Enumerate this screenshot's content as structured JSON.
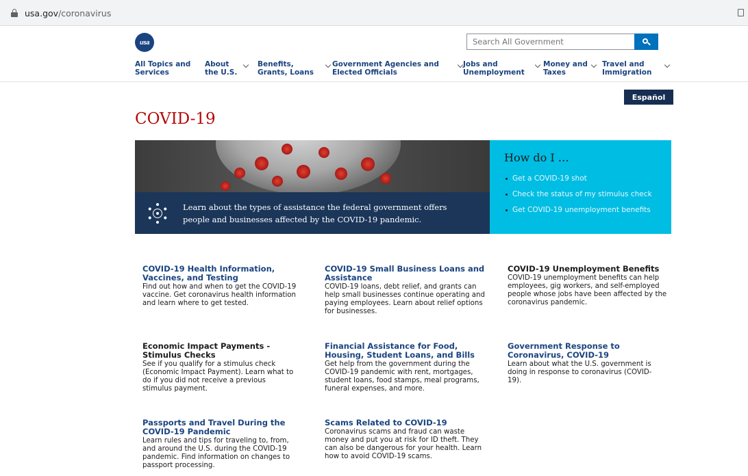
{
  "browser": {
    "url_host": "usa.gov",
    "url_path": "/coronavirus"
  },
  "header": {
    "logo_text": "usa",
    "search_placeholder": "Search All Government",
    "espanol_label": "Español"
  },
  "nav": [
    {
      "label": "All Topics and\nServices"
    },
    {
      "label": "About\nthe U.S."
    },
    {
      "label": "Benefits,\nGrants, Loans"
    },
    {
      "label": "Government Agencies and\nElected Officials"
    },
    {
      "label": "Jobs and\nUnemployment"
    },
    {
      "label": "Money and\nTaxes"
    },
    {
      "label": "Travel and\nImmigration"
    }
  ],
  "page": {
    "title": "COVID-19"
  },
  "hero": {
    "text": "Learn about the types of assistance the federal government offers people and businesses affected by the COVID-19 pandemic."
  },
  "howdoi": {
    "heading": "How do I …",
    "links": [
      "Get a COVID-19 shot",
      "Check the status of my stimulus check",
      "Get COVID-19 unemployment benefits"
    ]
  },
  "cards": [
    {
      "title": "COVID-19 Health Information, Vaccines, and Testing",
      "desc": "Find out how and when to get the COVID-19 vaccine. Get coronavirus health information and learn where to get tested."
    },
    {
      "title": "COVID-19 Small Business Loans and Assistance",
      "desc": "COVID-19 loans, debt relief, and grants can help small businesses continue operating and paying employees. Learn about relief options for businesses."
    },
    {
      "title": "COVID-19 Unemployment Benefits",
      "desc": "COVID-19 unemployment benefits can help employees, gig workers, and self-employed people whose jobs have been affected by the coronavirus pandemic."
    },
    {
      "title": "Economic Impact Payments - Stimulus Checks",
      "desc": "See if you qualify for a stimulus check (Economic Impact Payment). Learn what to do if you did not receive a previous stimulus payment."
    },
    {
      "title": "Financial Assistance for Food, Housing, Student Loans, and Bills",
      "desc": "Get help from the government during the COVID-19 pandemic with rent, mortgages, student loans, food stamps, meal programs, funeral expenses, and more."
    },
    {
      "title": "Government Response to Coronavirus, COVID-19",
      "desc": "Learn about what the U.S. government is doing in response to coronavirus (COVID-19)."
    },
    {
      "title": "Passports and Travel During the COVID-19 Pandemic",
      "desc": "Learn rules and tips for traveling to, from, and around the U.S. during the COVID-19 pandemic. Find information on changes to passport processing."
    },
    {
      "title": "Scams Related to COVID-19",
      "desc": "Coronavirus scams and fraud can waste money and put you at risk for ID theft. They can also be dangerous for your health. Learn how to avoid COVID-19 scams."
    }
  ],
  "colors": {
    "primary_blue": "#1a4480",
    "title_red": "#b50909",
    "howdoi_cyan": "#00bde3",
    "hero_navy": "#1b3659",
    "search_button": "#0071bc"
  }
}
